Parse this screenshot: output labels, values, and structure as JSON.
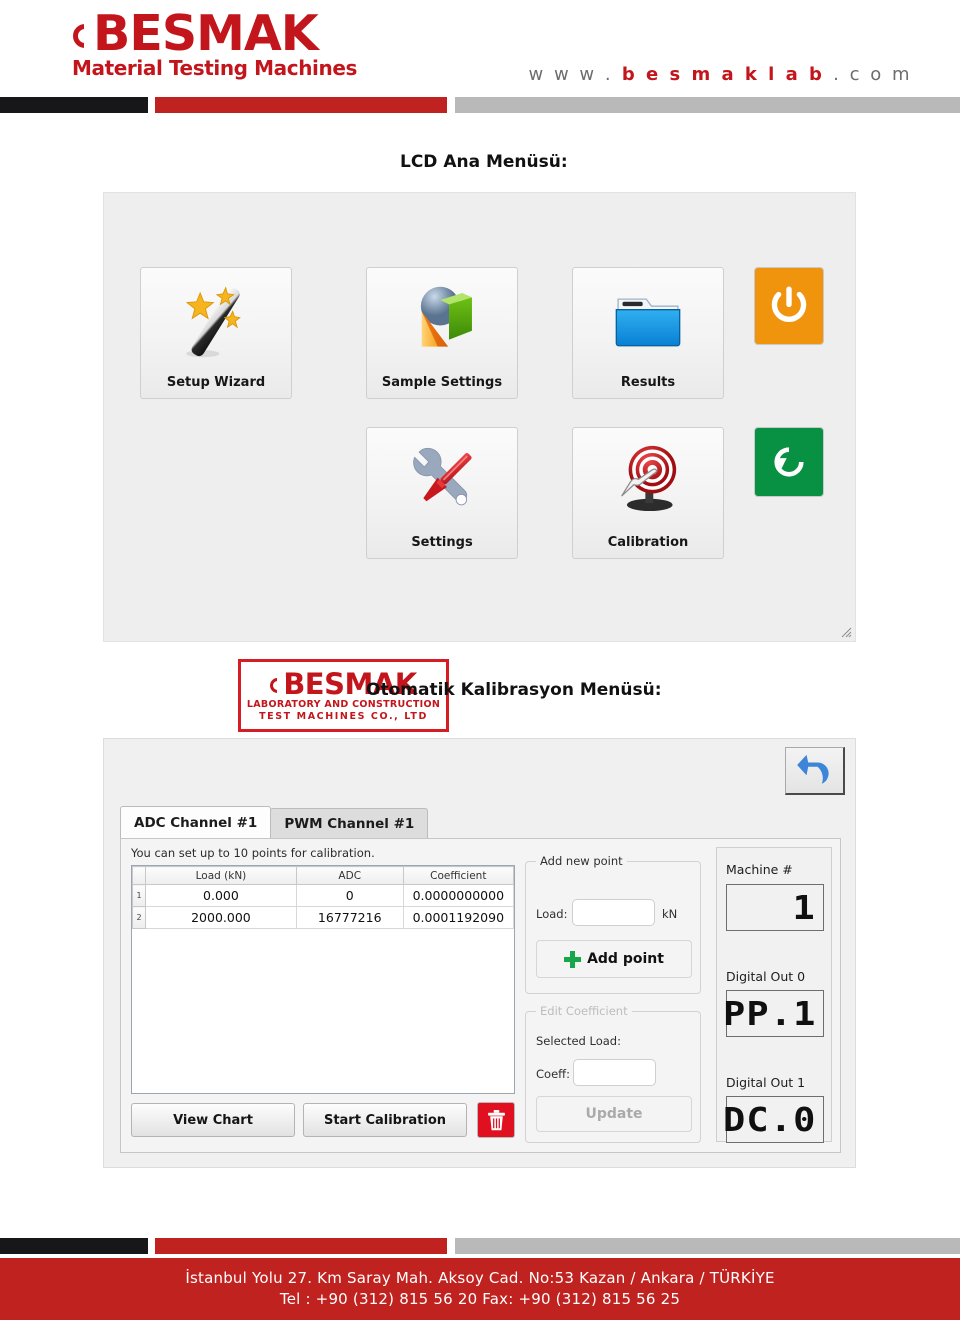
{
  "header": {
    "logo_main": "BESMAK",
    "logo_sub": "Material Testing Machines",
    "url_prefix": "w w w .",
    "url_brand": " b e s m a k l a b ",
    "url_suffix": ". c o m"
  },
  "sections": {
    "lcd_menu_title": "LCD Ana Menüsü:",
    "calibration_title": "Otomatik Kalibrasyon Menüsü:"
  },
  "lcd_menu": {
    "tiles": [
      {
        "label": "Setup Wizard",
        "icon": "magic-wand-icon"
      },
      {
        "label": "Sample Settings",
        "icon": "shapes-icon"
      },
      {
        "label": "Results",
        "icon": "folder-icon"
      },
      {
        "label": "Settings",
        "icon": "tools-icon"
      },
      {
        "label": "Calibration",
        "icon": "target-icon"
      }
    ],
    "power_button": {
      "icon": "power-icon",
      "color": "#f0940e"
    },
    "refresh_button": {
      "icon": "restart-icon",
      "color": "#089143"
    },
    "brand_box": {
      "main": "BESMAK",
      "line1": "LABORATORY AND CONSTRUCTION",
      "line2": "TEST MACHINES CO., LTD"
    }
  },
  "calibration": {
    "undo_button_icon": "undo-arrow-icon",
    "tabs": [
      {
        "label": "ADC Channel #1",
        "active": true
      },
      {
        "label": "PWM Channel #1",
        "active": false
      }
    ],
    "hint": "You can set up to 10 points for calibration.",
    "table": {
      "columns": [
        "Load (kN)",
        "ADC",
        "Coefficient"
      ],
      "rows": [
        {
          "index": "1",
          "load": "0.000",
          "adc": "0",
          "coefficient": "0.0000000000"
        },
        {
          "index": "2",
          "load": "2000.000",
          "adc": "16777216",
          "coefficient": "0.0001192090"
        }
      ]
    },
    "buttons": {
      "view_chart": "View Chart",
      "start_calibration": "Start Calibration",
      "delete_icon": "trash-icon"
    },
    "add_point": {
      "title": "Add new point",
      "load_label": "Load:",
      "load_value": "",
      "unit": "kN",
      "button_label": "Add point",
      "button_icon": "plus-icon"
    },
    "edit_coefficient": {
      "title": "Edit Coefficient",
      "selected_load_label": "Selected Load:",
      "coeff_label": "Coeff:",
      "coeff_value": "",
      "button_label": "Update",
      "disabled": true
    },
    "machine": {
      "machine_label": "Machine #",
      "machine_value": "1",
      "digital_out_0_label": "Digital Out 0",
      "digital_out_0_value": "PP.1",
      "digital_out_1_label": "Digital Out 1",
      "digital_out_1_value": "DC.0"
    }
  },
  "footer": {
    "address": "İstanbul Yolu 27. Km Saray Mah. Aksoy Cad. No:53 Kazan / Ankara / TÜRKİYE",
    "contact": "Tel :  +90 (312) 815 56 20  Fax:  +90 (312) 815 56 25"
  }
}
